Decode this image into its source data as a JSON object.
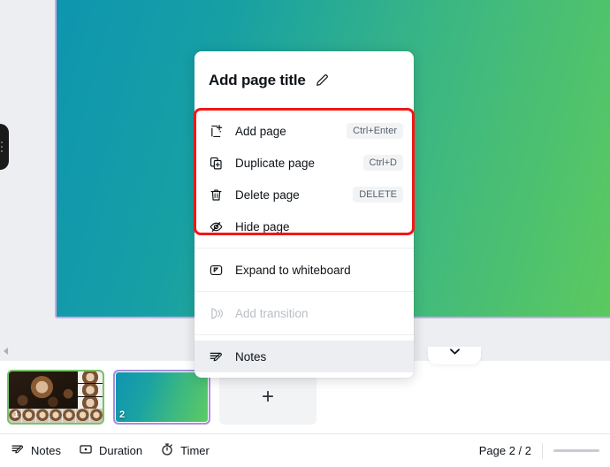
{
  "app": {
    "canvas": {
      "gradient_from": "#0e95b0",
      "gradient_to": "#5cc95f",
      "selection_border": "#c9a9ea"
    },
    "annotation": {
      "color": "#f41616"
    }
  },
  "context_menu": {
    "title": "Add page title",
    "title_edit_icon": "pencil-icon",
    "groups": [
      {
        "id": "page-actions",
        "highlighted": true,
        "items": [
          {
            "icon": "add-page-icon",
            "label": "Add page",
            "shortcut": "Ctrl+Enter",
            "disabled": false
          },
          {
            "icon": "duplicate-page-icon",
            "label": "Duplicate page",
            "shortcut": "Ctrl+D",
            "disabled": false
          },
          {
            "icon": "trash-icon",
            "label": "Delete page",
            "shortcut": "DELETE",
            "disabled": false
          },
          {
            "icon": "eye-off-icon",
            "label": "Hide page",
            "shortcut": "",
            "disabled": false
          }
        ]
      },
      {
        "id": "whiteboard",
        "highlighted": false,
        "items": [
          {
            "icon": "expand-whiteboard-icon",
            "label": "Expand to whiteboard",
            "shortcut": "",
            "disabled": false
          }
        ]
      },
      {
        "id": "transition",
        "highlighted": false,
        "items": [
          {
            "icon": "transition-icon",
            "label": "Add transition",
            "shortcut": "",
            "disabled": true
          }
        ]
      },
      {
        "id": "notes",
        "highlighted": false,
        "items": [
          {
            "icon": "notes-icon",
            "label": "Notes",
            "shortcut": "",
            "disabled": false,
            "hovered": true
          }
        ]
      }
    ],
    "collapse_icon": "chevron-down-icon"
  },
  "thumbnails": {
    "items": [
      {
        "number": "1",
        "label": "coffee-slide",
        "selected": false
      },
      {
        "number": "2",
        "label": "gradient-slide",
        "selected": true
      }
    ],
    "add_label": "+"
  },
  "bottom_bar": {
    "buttons": [
      {
        "icon": "notes-icon",
        "label": "Notes"
      },
      {
        "icon": "duration-icon",
        "label": "Duration"
      },
      {
        "icon": "timer-icon",
        "label": "Timer"
      }
    ],
    "page_indicator": "Page 2 / 2"
  }
}
